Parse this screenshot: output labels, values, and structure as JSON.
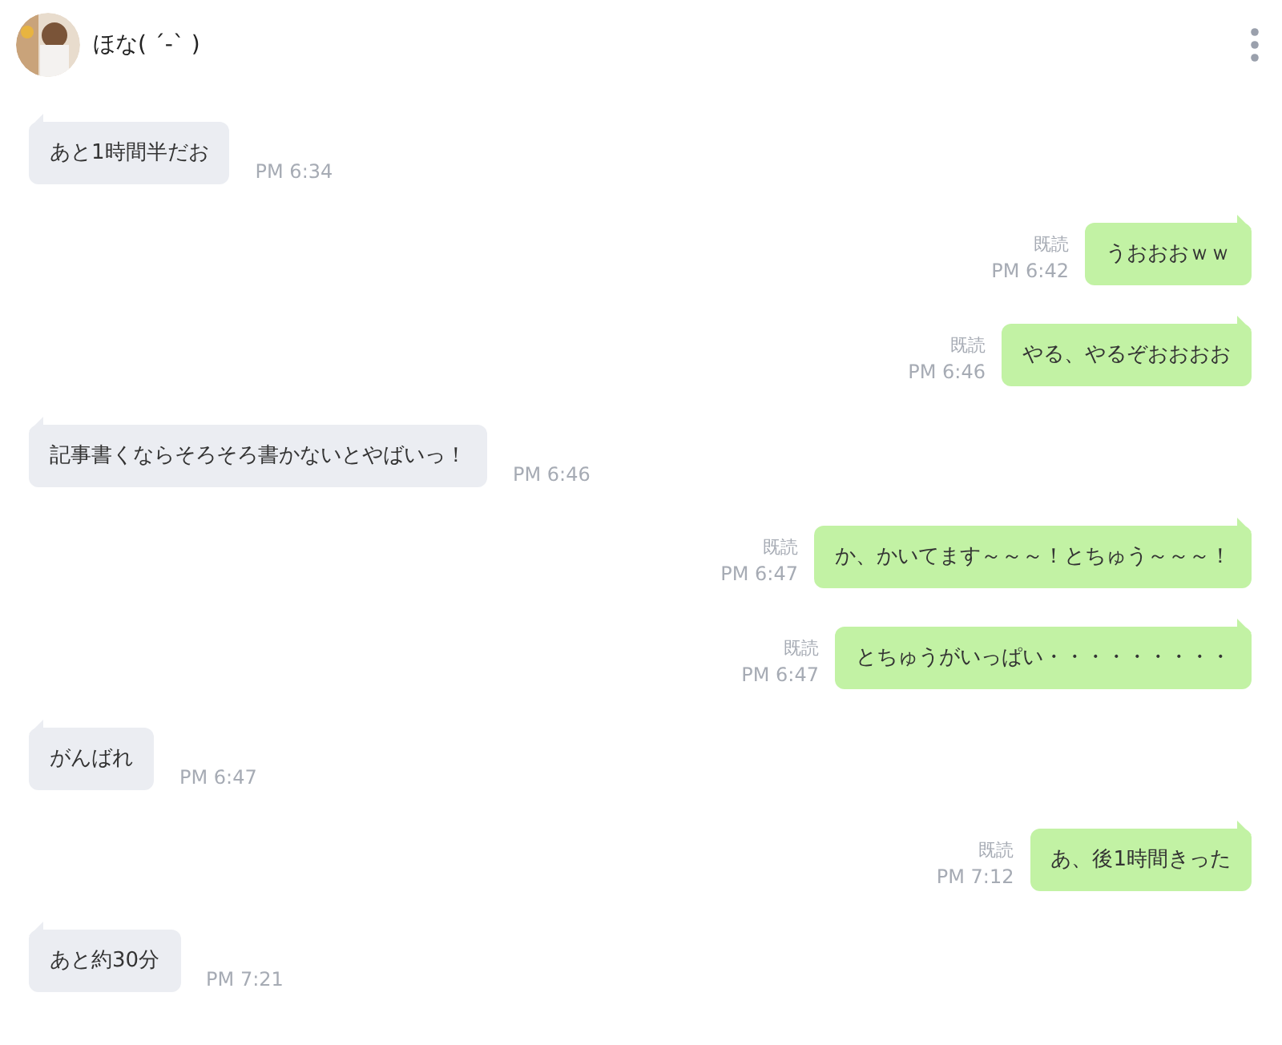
{
  "header": {
    "name": "ほな( ˊ-ˋ )"
  },
  "messages": [
    {
      "kind": "left",
      "text": "あと1時間半だお",
      "time": "PM 6:34"
    },
    {
      "kind": "right",
      "text": "うおおおｗｗ",
      "read": "既読",
      "time": "PM 6:42"
    },
    {
      "kind": "right",
      "text": "やる、やるぞおおおお",
      "read": "既読",
      "time": "PM 6:46"
    },
    {
      "kind": "left",
      "text": "記事書くならそろそろ書かないとやばいっ！",
      "time": "PM 6:46"
    },
    {
      "kind": "right",
      "text": "か、かいてます～～～！とちゅう～～～！",
      "read": "既読",
      "time": "PM 6:47"
    },
    {
      "kind": "right",
      "text": "とちゅうがいっぱい・・・・・・・・・",
      "read": "既読",
      "time": "PM 6:47"
    },
    {
      "kind": "left",
      "text": "がんばれ",
      "time": "PM 6:47"
    },
    {
      "kind": "right",
      "text": "あ、後1時間きった",
      "read": "既読",
      "time": "PM 7:12"
    },
    {
      "kind": "left",
      "text": "あと約30分",
      "time": "PM 7:21"
    }
  ]
}
